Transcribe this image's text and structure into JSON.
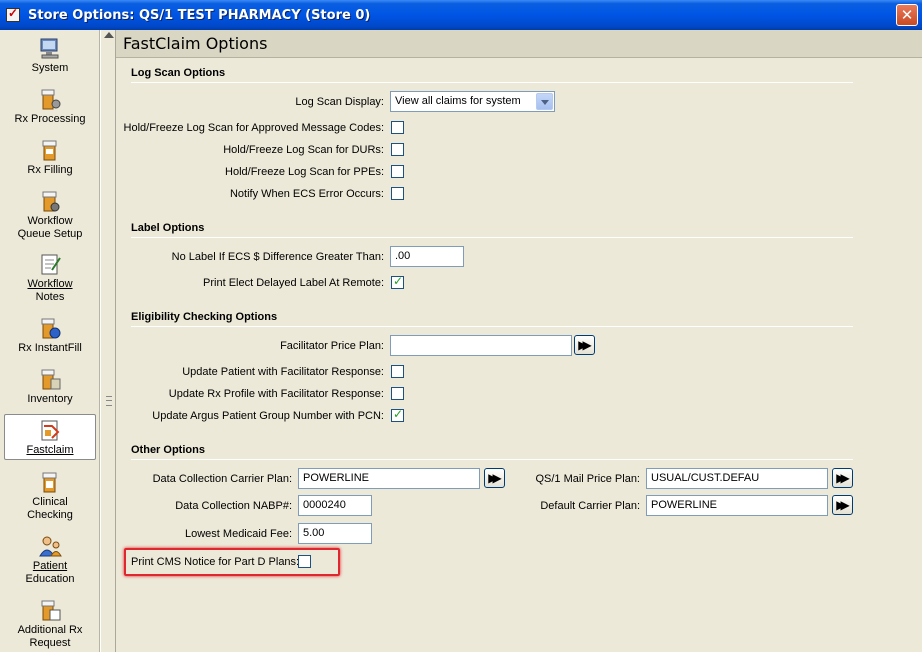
{
  "window": {
    "title": "Store Options: QS/1 TEST PHARMACY (Store 0)",
    "close_glyph": "✕"
  },
  "sidebar": {
    "items": [
      {
        "label": "System",
        "icon": "computer-icon"
      },
      {
        "label": "Rx Processing",
        "icon": "pill-bottle-gear-icon"
      },
      {
        "label": "Rx Filling",
        "icon": "pill-bottle-icon"
      },
      {
        "label": "Workflow Queue Setup",
        "line1": "Workflow",
        "line2": "Queue Setup",
        "icon": "workflow-queue-icon"
      },
      {
        "label": "Workflow Notes",
        "line1": "Workflow",
        "line2": "Notes",
        "icon": "notes-icon"
      },
      {
        "label": "Rx InstantFill",
        "icon": "instantfill-icon"
      },
      {
        "label": "Inventory",
        "icon": "inventory-icon"
      },
      {
        "label": "Fastclaim",
        "icon": "fastclaim-icon",
        "active": true
      },
      {
        "label": "Clinical Checking",
        "line1": "Clinical",
        "line2": "Checking",
        "icon": "clinical-icon"
      },
      {
        "label": "Patient Education",
        "line1": "Patient",
        "line2": "Education",
        "icon": "patient-icon"
      },
      {
        "label": "Additional Rx Request",
        "line1": "Additional Rx",
        "line2": "Request",
        "icon": "rx-request-icon"
      }
    ]
  },
  "main": {
    "header": "FastClaim Options",
    "log_scan": {
      "title": "Log Scan Options",
      "display_label": "Log Scan Display:",
      "display_value": "View all claims for system",
      "hold_approved_label": "Hold/Freeze Log Scan for Approved Message Codes:",
      "hold_approved": false,
      "hold_durs_label": "Hold/Freeze Log Scan for DURs:",
      "hold_durs": false,
      "hold_ppes_label": "Hold/Freeze Log Scan for PPEs:",
      "hold_ppes": false,
      "notify_label": "Notify When ECS Error Occurs:",
      "notify": false
    },
    "label_options": {
      "title": "Label Options",
      "no_label_label": "No Label If ECS $ Difference Greater Than:",
      "no_label_value": ".00",
      "print_elect_label": "Print Elect Delayed Label At Remote:",
      "print_elect": true
    },
    "eligibility": {
      "title": "Eligibility Checking Options",
      "price_plan_label": "Facilitator Price Plan:",
      "price_plan_value": "",
      "update_patient_label": "Update Patient with Facilitator Response:",
      "update_patient": false,
      "update_rx_label": "Update Rx Profile with Facilitator Response:",
      "update_rx": false,
      "update_argus_label": "Update Argus Patient Group Number with PCN:",
      "update_argus": true
    },
    "other": {
      "title": "Other Options",
      "carrier_plan_label": "Data Collection Carrier Plan:",
      "carrier_plan_value": "POWERLINE",
      "nabp_label": "Data Collection NABP#:",
      "nabp_value": "0000240",
      "medicaid_label": "Lowest Medicaid Fee:",
      "medicaid_value": "5.00",
      "mail_price_label": "QS/1 Mail Price Plan:",
      "mail_price_value": "USUAL/CUST.DEFAU",
      "default_carrier_label": "Default Carrier Plan:",
      "default_carrier_value": "POWERLINE",
      "cms_label": "Print CMS Notice for Part D Plans:",
      "cms": false
    },
    "ff_glyph": "▶▶"
  }
}
